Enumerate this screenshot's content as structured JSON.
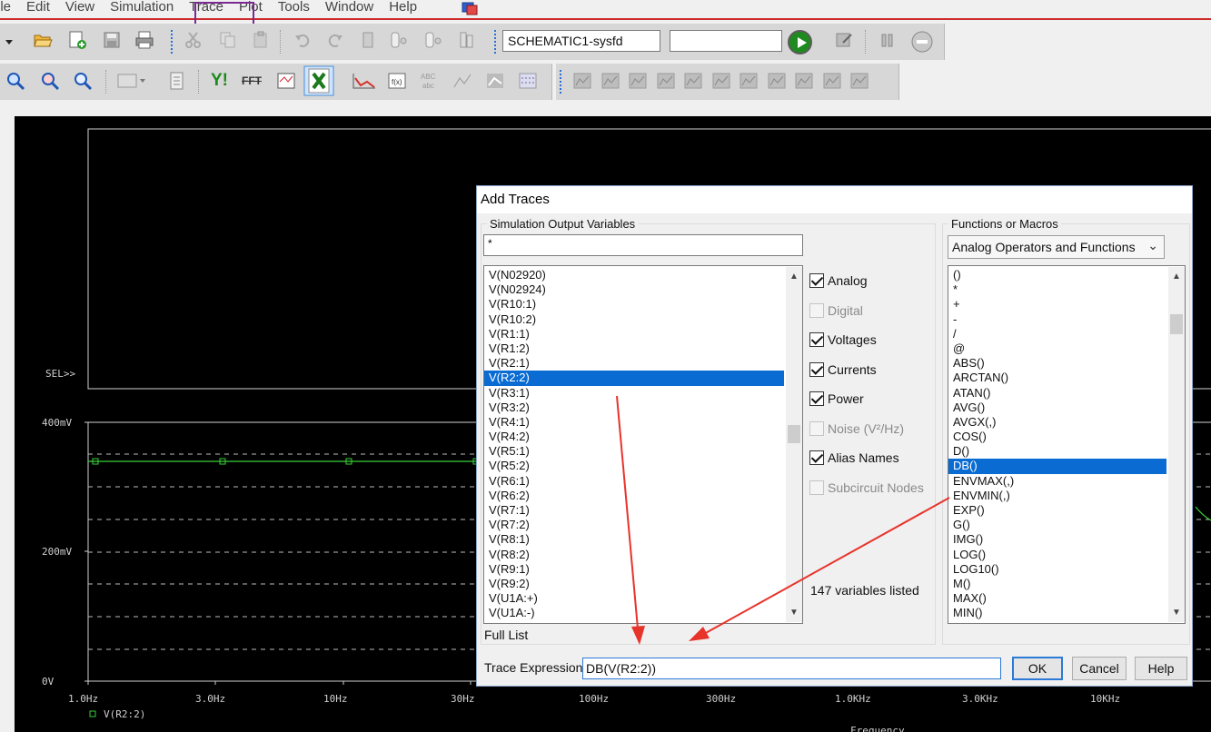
{
  "menu": [
    "ile",
    "Edit",
    "View",
    "Simulation",
    "Trace",
    "Plot",
    "Tools",
    "Window",
    "Help"
  ],
  "toolbar": {
    "schematic": "SCHEMATIC1-sysfd",
    "sim_input": "",
    "yaxis_label": "Y!",
    "fft_label": "FFT"
  },
  "plot": {
    "sel_label": "SEL>>",
    "y_ticks": [
      "400mV",
      "200mV",
      "0V"
    ],
    "x_ticks": [
      "1.0Hz",
      "3.0Hz",
      "10Hz",
      "30Hz",
      "100Hz",
      "300Hz",
      "1.0KHz",
      "3.0KHz",
      "10KHz"
    ],
    "legend": "V(R2:2)",
    "x_axis_title": "Frequency",
    "trace_color": "#38d038"
  },
  "dialog": {
    "title": "Add Traces",
    "sim_group_label": "Simulation Output Variables",
    "filter_value": "*",
    "variables": [
      "V(N02920)",
      "V(N02924)",
      "V(R10:1)",
      "V(R10:2)",
      "V(R1:1)",
      "V(R1:2)",
      "V(R2:1)",
      "V(R2:2)",
      "V(R3:1)",
      "V(R3:2)",
      "V(R4:1)",
      "V(R4:2)",
      "V(R5:1)",
      "V(R5:2)",
      "V(R6:1)",
      "V(R6:2)",
      "V(R7:1)",
      "V(R7:2)",
      "V(R8:1)",
      "V(R8:2)",
      "V(R9:1)",
      "V(R9:2)",
      "V(U1A:+)",
      "V(U1A:-)"
    ],
    "selected_variable": "V(R2:2)",
    "checkboxes": [
      {
        "label": "Analog",
        "checked": true,
        "enabled": true
      },
      {
        "label": "Digital",
        "checked": false,
        "enabled": false
      },
      {
        "label": "Voltages",
        "checked": true,
        "enabled": true
      },
      {
        "label": "Currents",
        "checked": true,
        "enabled": true
      },
      {
        "label": "Power",
        "checked": true,
        "enabled": true
      },
      {
        "label": "Noise (V²/Hz)",
        "checked": false,
        "enabled": false
      },
      {
        "label": "Alias Names",
        "checked": true,
        "enabled": true
      },
      {
        "label": "Subcircuit Nodes",
        "checked": false,
        "enabled": false
      }
    ],
    "count_text": "147 variables listed",
    "full_list": "Full List",
    "func_group_label": "Functions or Macros",
    "func_combo": "Analog Operators and Functions",
    "functions": [
      "()",
      "*",
      "+",
      "-",
      "/",
      "@",
      "ABS()",
      "ARCTAN()",
      "ATAN()",
      "AVG()",
      "AVGX(,)",
      "COS()",
      "D()",
      "DB()",
      "ENVMAX(,)",
      "ENVMIN(,)",
      "EXP()",
      "G()",
      "IMG()",
      "LOG()",
      "LOG10()",
      "M()",
      "MAX()",
      "MIN()"
    ],
    "selected_function": "DB()",
    "trace_expression_label": "Trace Expression:",
    "trace_expression": "DB(V(R2:2))",
    "ok": "OK",
    "cancel": "Cancel",
    "help": "Help"
  },
  "colors": {
    "selection": "#0a6cd2",
    "annotation": "#e8332a",
    "trace_menu_highlight": "#7a2a92"
  }
}
